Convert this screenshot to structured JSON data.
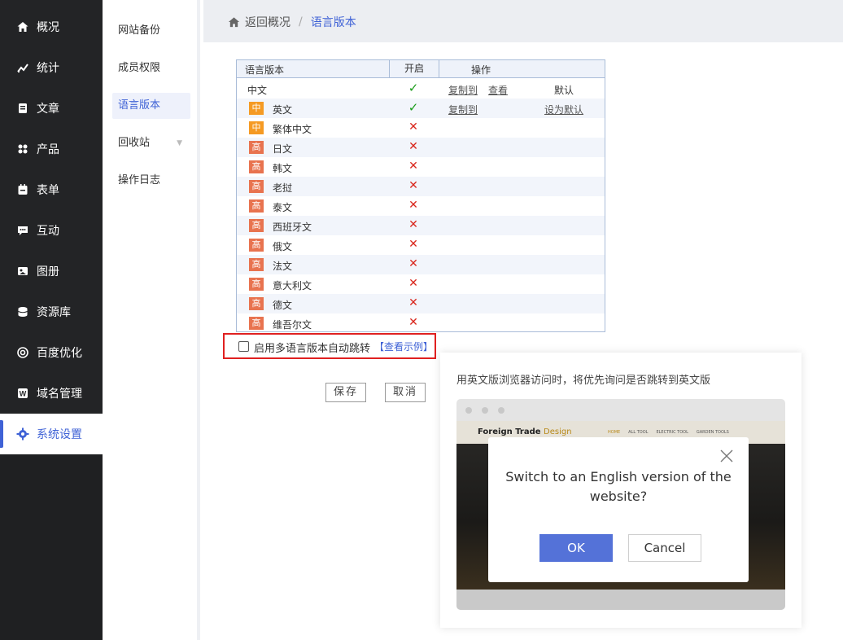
{
  "nav": {
    "items": [
      {
        "label": "概况",
        "icon": "home-icon"
      },
      {
        "label": "统计",
        "icon": "stats-icon"
      },
      {
        "label": "文章",
        "icon": "article-icon"
      },
      {
        "label": "产品",
        "icon": "product-icon"
      },
      {
        "label": "表单",
        "icon": "form-icon"
      },
      {
        "label": "互动",
        "icon": "chat-icon"
      },
      {
        "label": "图册",
        "icon": "gallery-icon"
      },
      {
        "label": "资源库",
        "icon": "database-icon"
      },
      {
        "label": "百度优化",
        "icon": "seo-icon"
      },
      {
        "label": "域名管理",
        "icon": "domain-icon"
      },
      {
        "label": "系统设置",
        "icon": "gear-icon"
      }
    ],
    "active_color": "#3f62d6"
  },
  "sub": {
    "items": [
      {
        "label": "网站备份"
      },
      {
        "label": "成员权限"
      },
      {
        "label": "语言版本"
      },
      {
        "label": "回收站"
      },
      {
        "label": "操作日志"
      }
    ]
  },
  "breadcrumb": {
    "back": "返回概况",
    "separator": "/",
    "current": "语言版本"
  },
  "table": {
    "headers": [
      "语言版本",
      "开启",
      "操作"
    ],
    "rows": [
      {
        "badge": "",
        "name": "中文",
        "enabled": true,
        "op1": "复制到",
        "op2": "查看",
        "default": "默认",
        "set_default": ""
      },
      {
        "badge": "中",
        "name": "英文",
        "enabled": true,
        "op1": "复制到",
        "op2": "",
        "default": "",
        "set_default": "设为默认"
      },
      {
        "badge": "中",
        "name": "繁体中文",
        "enabled": false
      },
      {
        "badge": "高",
        "name": "日文",
        "enabled": false
      },
      {
        "badge": "高",
        "name": "韩文",
        "enabled": false
      },
      {
        "badge": "高",
        "name": "老挝",
        "enabled": false
      },
      {
        "badge": "高",
        "name": "泰文",
        "enabled": false
      },
      {
        "badge": "高",
        "name": "西班牙文",
        "enabled": false
      },
      {
        "badge": "高",
        "name": "俄文",
        "enabled": false
      },
      {
        "badge": "高",
        "name": "法文",
        "enabled": false
      },
      {
        "badge": "高",
        "name": "意大利文",
        "enabled": false
      },
      {
        "badge": "高",
        "name": "德文",
        "enabled": false
      },
      {
        "badge": "高",
        "name": "维吾尔文",
        "enabled": false
      }
    ],
    "check_glyph": "✓",
    "cross_glyph": "✕"
  },
  "auto_redirect": {
    "checked": false,
    "label": "启用多语言版本自动跳转",
    "link": "【查看示例】"
  },
  "buttons": {
    "save": "保存",
    "cancel": "取消"
  },
  "example": {
    "description": "用英文版浏览器访问时，将优先询问是否跳转到英文版",
    "site_logo": "Foreign Trade",
    "site_logo_sub": "Design",
    "site_links": [
      "HOME",
      "ALL TOOL",
      "ELECTRIC TOOL",
      "GARDEN TOOLS"
    ],
    "dialog_question": "Switch to an English version of the website?",
    "ok": "OK",
    "cancel": "Cancel"
  }
}
